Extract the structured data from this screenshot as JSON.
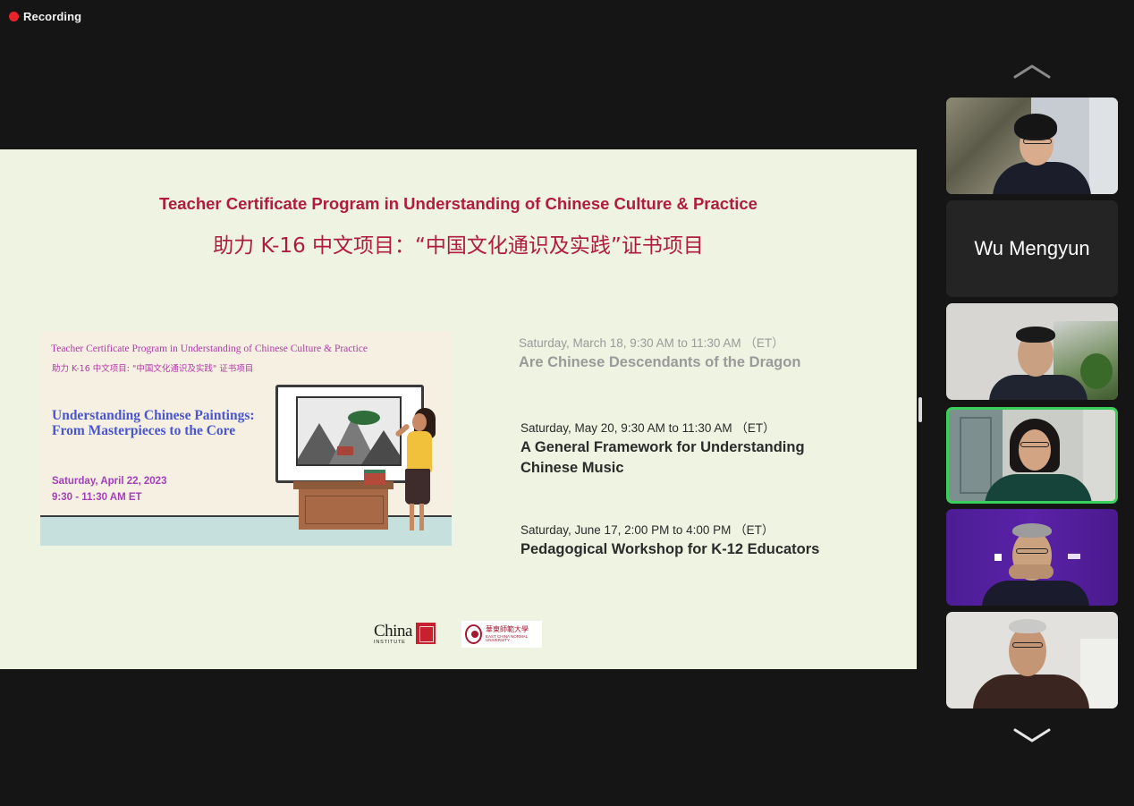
{
  "recording": {
    "label": "Recording"
  },
  "slide": {
    "title_en": "Teacher Certificate Program in Understanding of Chinese Culture & Practice",
    "title_zh": "助力 K-16 中文项目：“中国文化通识及实践”证书项目",
    "poster": {
      "title_en": "Teacher Certificate Program in Understanding of Chinese Culture & Practice",
      "title_zh": "助力 K-16 中文项目: \"中国文化通识及实践\" 证书项目",
      "event_title": "Understanding Chinese Paintings: From Masterpieces to the Core",
      "date": "Saturday, April 22, 2023",
      "time": "9:30 - 11:30 AM ET"
    },
    "agenda": [
      {
        "when": "Saturday, March 18, 9:30 AM to 11:30 AM （ET）",
        "title": "Are Chinese Descendants of the Dragon",
        "dimmed": true
      },
      {
        "when": "Saturday, May 20, 9:30 AM to 11:30 AM （ET）",
        "title": "A General Framework for Understanding Chinese Music",
        "dimmed": false
      },
      {
        "when": "Saturday, June 17, 2:00 PM to 4:00 PM （ET）",
        "title": "Pedagogical Workshop for K-12 Educators",
        "dimmed": false
      }
    ],
    "logos": {
      "china_institute": {
        "word": "China",
        "sub": "INSTITUTE"
      },
      "ecnu": {
        "zh": "華東師範大學",
        "en": "EAST CHINA NORMAL UNIVERSITY"
      }
    }
  },
  "participants": {
    "scroll_up_icon": "chevron-up-icon",
    "scroll_down_icon": "chevron-down-icon",
    "tiles": [
      {
        "type": "video",
        "name": ""
      },
      {
        "type": "name",
        "name": "Wu Mengyun"
      },
      {
        "type": "video",
        "name": ""
      },
      {
        "type": "video",
        "name": "",
        "active_speaker": true
      },
      {
        "type": "video",
        "name": ""
      },
      {
        "type": "video",
        "name": ""
      }
    ]
  },
  "colors": {
    "background": "#151515",
    "slide_bg": "#eef3e2",
    "slide_title": "#b01c3d",
    "recording_dot": "#e8232b",
    "active_speaker_border": "#38d05b",
    "poster_event": "#4a56cf",
    "poster_date": "#a53fb9"
  }
}
